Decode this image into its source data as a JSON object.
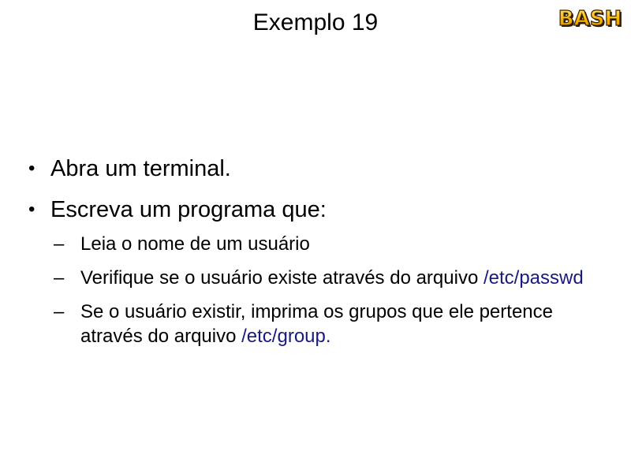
{
  "slide": {
    "title": "Exemplo 19",
    "logo_text": "BASH",
    "bullets": [
      {
        "marker": "•",
        "text": "Abra um terminal."
      },
      {
        "marker": "•",
        "text": "Escreva um programa que:"
      }
    ],
    "sub_items": [
      {
        "marker": "–",
        "text": "Leia o nome de um usuário",
        "path": "",
        "tail": ""
      },
      {
        "marker": "–",
        "text": "Verifique se o usuário existe através do arquivo ",
        "path": "/etc/passwd",
        "tail": ""
      },
      {
        "marker": "–",
        "text": "Se o usuário existir, imprima os grupos que ele pertence através do arquivo ",
        "path": "/etc/group",
        "tail": "."
      }
    ]
  },
  "colors": {
    "path": "#1a1a7e",
    "logo_fill": "#f5b800",
    "logo_stroke": "#3a2200"
  }
}
